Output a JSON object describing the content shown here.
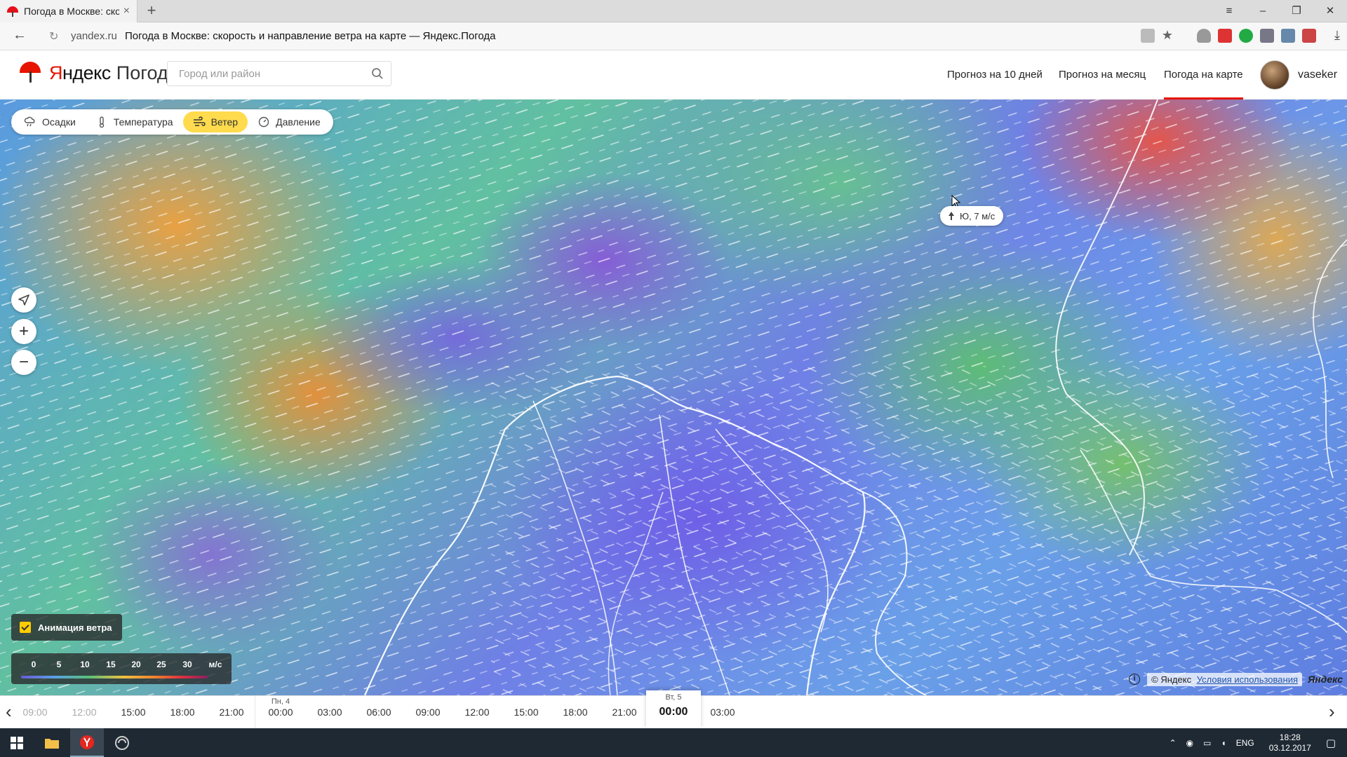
{
  "browser": {
    "tab_title": "Погода в Москве: скоро",
    "tab_close": "×",
    "new_tab": "+",
    "domain": "yandex.ru",
    "page_title": "Погода в Москве: скорость и направление ветра на карте — Яндекс.Погода"
  },
  "header": {
    "brand_a": "Я",
    "brand_b": "ндекс",
    "product": "Погода",
    "search_placeholder": "Город или район",
    "nav": [
      "Прогноз на 10 дней",
      "Прогноз на месяц",
      "Погода на карте"
    ],
    "active_nav": "Погода на карте",
    "username": "vaseker"
  },
  "map": {
    "layers": [
      {
        "label": "Осадки",
        "icon": "cloud-rain-icon"
      },
      {
        "label": "Температура",
        "icon": "thermometer-icon"
      },
      {
        "label": "Ветер",
        "icon": "wind-icon",
        "active": true
      },
      {
        "label": "Давление",
        "icon": "gauge-icon"
      }
    ],
    "tooltip": "Ю, 7 м/с",
    "animation_label": "Анимация ветра",
    "legend": {
      "values": [
        "0",
        "5",
        "10",
        "15",
        "20",
        "25",
        "30"
      ],
      "unit": "м/с"
    },
    "copyright": "© Яндекс",
    "terms": "Условия использования",
    "yandex_logo": "Яндекс",
    "info": "i",
    "zoom_in": "+",
    "zoom_out": "−",
    "accent_color": "#ffdb4d"
  },
  "timeline": {
    "prev": "‹",
    "next": "›",
    "slots": [
      {
        "t": "09:00",
        "state": "past"
      },
      {
        "t": "12:00",
        "state": "past"
      },
      {
        "t": "15:00"
      },
      {
        "t": "18:00"
      },
      {
        "t": "21:00"
      },
      {
        "t": "00:00",
        "day": "Пн, 4"
      },
      {
        "t": "03:00"
      },
      {
        "t": "06:00"
      },
      {
        "t": "09:00"
      },
      {
        "t": "12:00"
      },
      {
        "t": "15:00"
      },
      {
        "t": "18:00"
      },
      {
        "t": "21:00"
      },
      {
        "t": "00:00",
        "day": "Вт, 5",
        "state": "current"
      },
      {
        "t": "03:00"
      }
    ]
  },
  "taskbar": {
    "lang": "ENG",
    "time": "18:28",
    "date": "03.12.2017"
  }
}
